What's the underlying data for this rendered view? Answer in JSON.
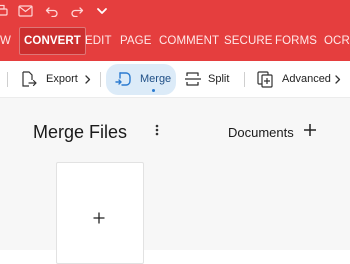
{
  "colors": {
    "brand_red": "#e53e3e",
    "active_tab_red": "#cc2f2f",
    "merge_highlight": "#dcebf8",
    "accent_blue": "#2b7bd0",
    "main_background": "#f7f7f7"
  },
  "titlebar": {
    "icons": [
      "print-icon",
      "mail-icon",
      "undo-icon",
      "redo-icon",
      "chevron-down-icon"
    ]
  },
  "ribbon": {
    "tabs": [
      {
        "label": "W",
        "active": false
      },
      {
        "label": "CONVERT",
        "active": true
      },
      {
        "label": "EDIT",
        "active": false
      },
      {
        "label": "PAGE",
        "active": false
      },
      {
        "label": "COMMENT",
        "active": false
      },
      {
        "label": "SECURE",
        "active": false
      },
      {
        "label": "FORMS",
        "active": false
      },
      {
        "label": "OCR",
        "active": false
      }
    ]
  },
  "toolbar": {
    "export_label": "Export",
    "merge_label": "Merge",
    "split_label": "Split",
    "advanced_label": "Advanced"
  },
  "main": {
    "title": "Merge Files",
    "documents_label": "Documents"
  }
}
